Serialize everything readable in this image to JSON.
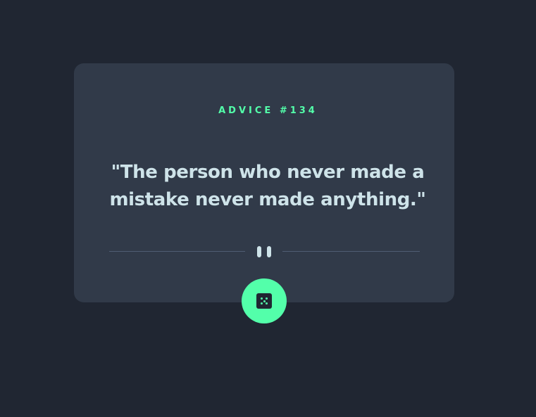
{
  "advice": {
    "id_label": "ADVICE #134",
    "quote": "\"The person who never made a mistake never made anything.\""
  },
  "icons": {
    "divider": "pause-icon",
    "button": "dice-icon"
  },
  "colors": {
    "background": "#202632",
    "card": "#313A49",
    "accent": "#53FFAA",
    "text": "#CEE3E9",
    "divider": "#4F5D74"
  }
}
